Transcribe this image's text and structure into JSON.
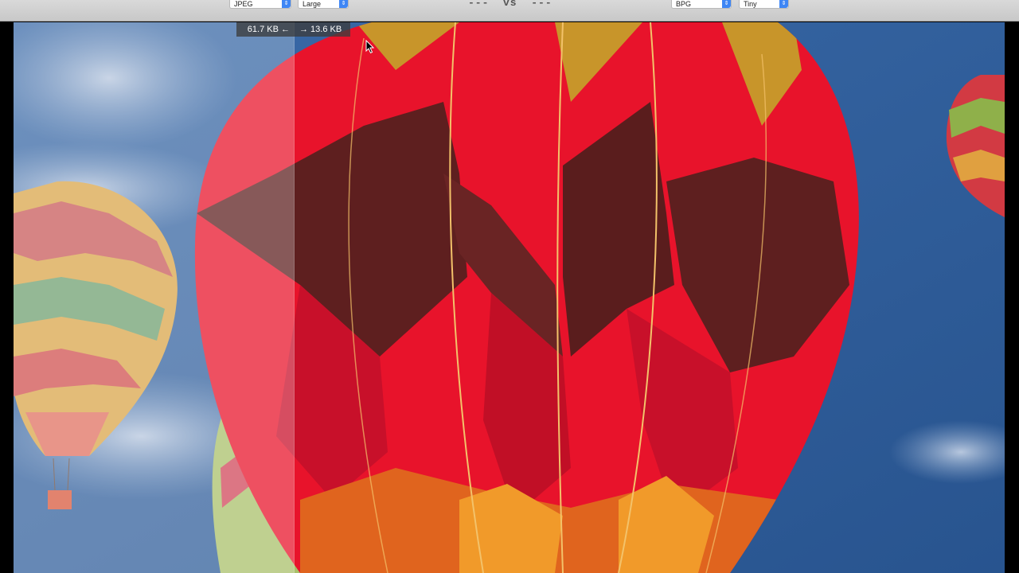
{
  "toolbar": {
    "left_format": "JPEG",
    "left_quality": "Large",
    "vs_label": "---  vs  ---",
    "right_format": "BPG",
    "right_quality": "Tiny"
  },
  "viewer": {
    "left_size": "61.7 KB ←",
    "right_size": "→ 13.6 KB"
  },
  "icons": {
    "dropdown": "chevron-updown-icon",
    "cursor": "mouse-pointer-icon"
  },
  "colors": {
    "accent": "#3e86f5",
    "sky": "#2e5f9f",
    "balloon_red": "#e8132b",
    "balloon_dark": "#5a1f1f",
    "balloon_gold": "#c8952a"
  }
}
